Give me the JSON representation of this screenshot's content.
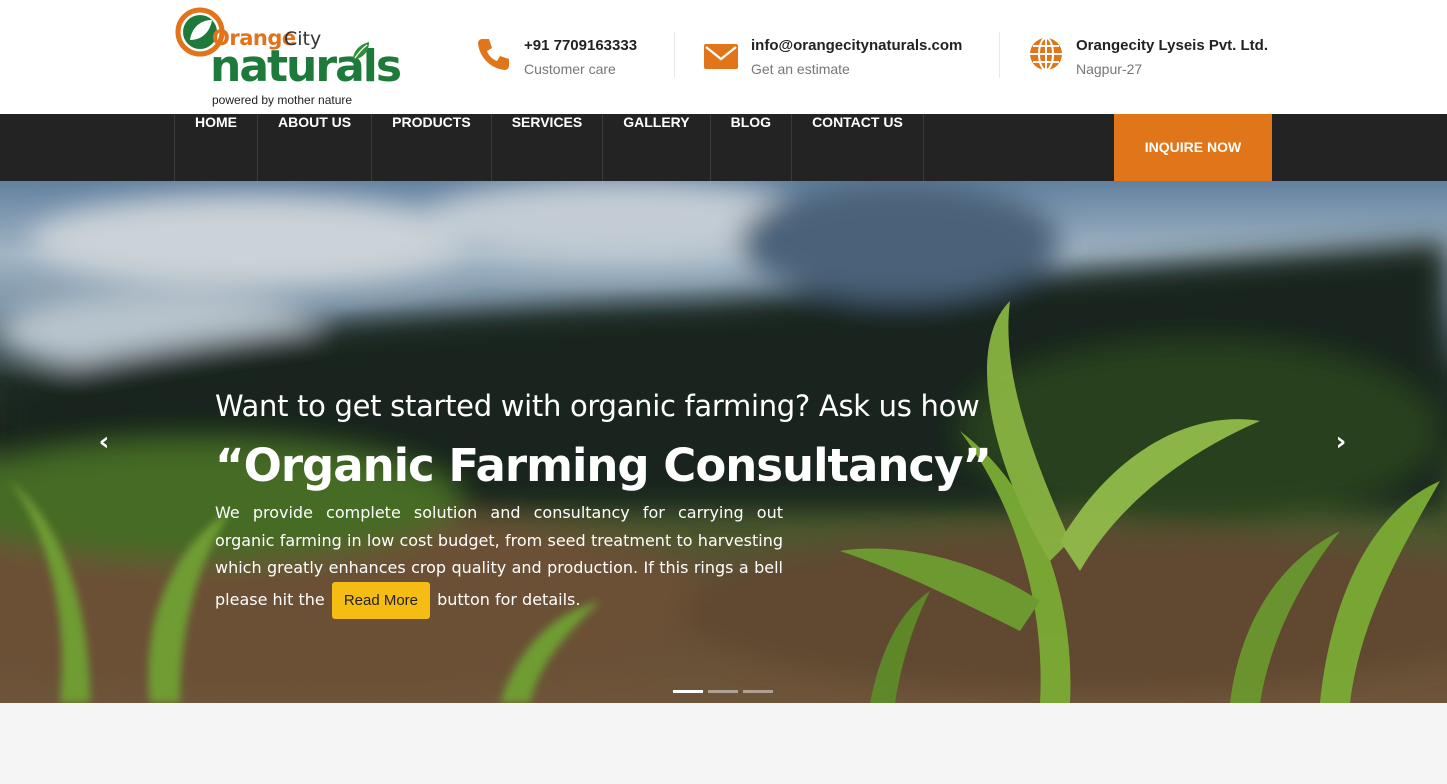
{
  "brand": {
    "word_orange": "Orange",
    "word_city": "City",
    "word_naturals": "naturals",
    "tagline": "powered by mother nature"
  },
  "contacts": [
    {
      "line1": "+91 7709163333",
      "line2": "Customer care",
      "icon": "phone-icon"
    },
    {
      "line1": "info@orangecitynaturals.com",
      "line2": "Get an estimate",
      "icon": "envelope-icon"
    },
    {
      "line1": "Orangecity Lyseis Pvt. Ltd.",
      "line2": "Nagpur-27",
      "icon": "globe-icon"
    }
  ],
  "nav": {
    "items": [
      "HOME",
      "ABOUT US",
      "PRODUCTS",
      "SERVICES",
      "GALLERY",
      "BLOG",
      "CONTACT US"
    ],
    "cta": "INQUIRE NOW"
  },
  "hero": {
    "subtitle": "Want to get started with organic farming? Ask us how",
    "title": "“Organic Farming Consultancy”",
    "body_before": "We provide complete solution and consultancy for carrying out organic farming in low cost budget, from seed treatment to harvesting which greatly enhances crop quality and production. If this rings a bell please hit the",
    "button": "Read More",
    "body_after": "button for details.",
    "prev_icon": "chevron-left-icon",
    "next_icon": "chevron-right-icon",
    "slide_count": 3,
    "active_slide": 1
  },
  "colors": {
    "accent_orange": "#e07519",
    "nav_bg": "#232323",
    "button_yellow": "#f5bd13",
    "brand_green": "#1e7a3a"
  }
}
